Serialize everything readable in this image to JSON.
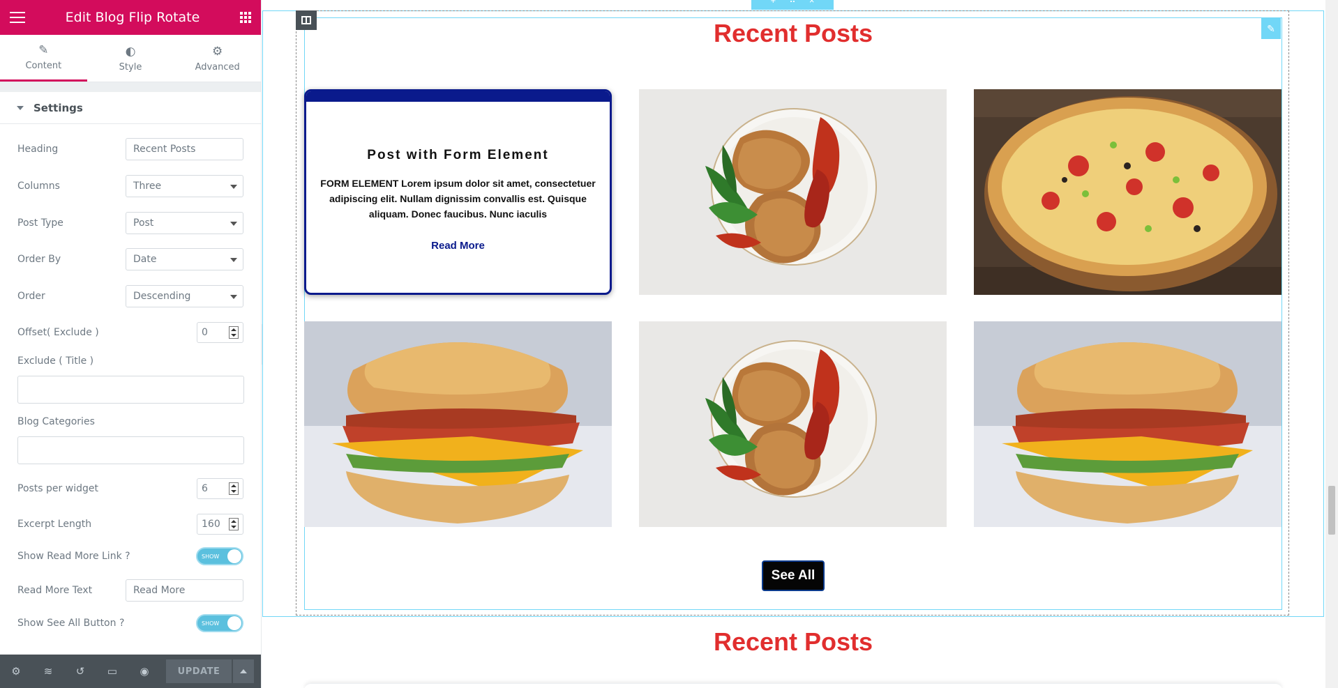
{
  "panel": {
    "title": "Edit Blog Flip Rotate",
    "tabs": [
      {
        "label": "Content",
        "icon": "pencil-icon"
      },
      {
        "label": "Style",
        "icon": "half-circle-icon"
      },
      {
        "label": "Advanced",
        "icon": "gear-icon"
      }
    ],
    "section": "Settings",
    "controls": {
      "heading": {
        "label": "Heading",
        "value": "Recent Posts"
      },
      "columns": {
        "label": "Columns",
        "value": "Three"
      },
      "post_type": {
        "label": "Post Type",
        "value": "Post"
      },
      "order_by": {
        "label": "Order By",
        "value": "Date"
      },
      "order": {
        "label": "Order",
        "value": "Descending"
      },
      "offset": {
        "label": "Offset( Exclude )",
        "value": "0"
      },
      "exclude_title": {
        "label": "Exclude ( Title )",
        "value": ""
      },
      "blog_categories": {
        "label": "Blog Categories",
        "value": ""
      },
      "posts_per_widget": {
        "label": "Posts per widget",
        "value": "6"
      },
      "excerpt_length": {
        "label": "Excerpt Length",
        "value": "160"
      },
      "show_read_more": {
        "label": "Show Read More Link ?",
        "state": "SHOW"
      },
      "read_more_text": {
        "label": "Read More Text",
        "value": "Read More"
      },
      "show_see_all": {
        "label": "Show See All Button ?",
        "state": "SHOW"
      }
    },
    "footer": {
      "update_label": "UPDATE"
    }
  },
  "canvas": {
    "heading": "Recent Posts",
    "heading_2": "Recent Posts",
    "flip_card": {
      "title": "Post with Form Element",
      "excerpt": "FORM ELEMENT Lorem ipsum dolor sit amet, consectetuer adipiscing elit. Nullam dignissim convallis est. Quisque aliquam. Donec faucibus. Nunc iaculis",
      "read_more": "Read More"
    },
    "posts": [
      {
        "image": "fried-cutlets-plate"
      },
      {
        "image": "pizza"
      },
      {
        "image": "biscuit-sandwich"
      },
      {
        "image": "fried-cutlets-plate"
      },
      {
        "image": "biscuit-sandwich"
      }
    ],
    "see_all": "See All"
  },
  "colors": {
    "brand": "#d30c5c",
    "heading_red": "#e12e2e",
    "card_navy": "#0a1a8c",
    "editor_outline": "#71d7f7",
    "toggle_on": "#5bc0de"
  }
}
